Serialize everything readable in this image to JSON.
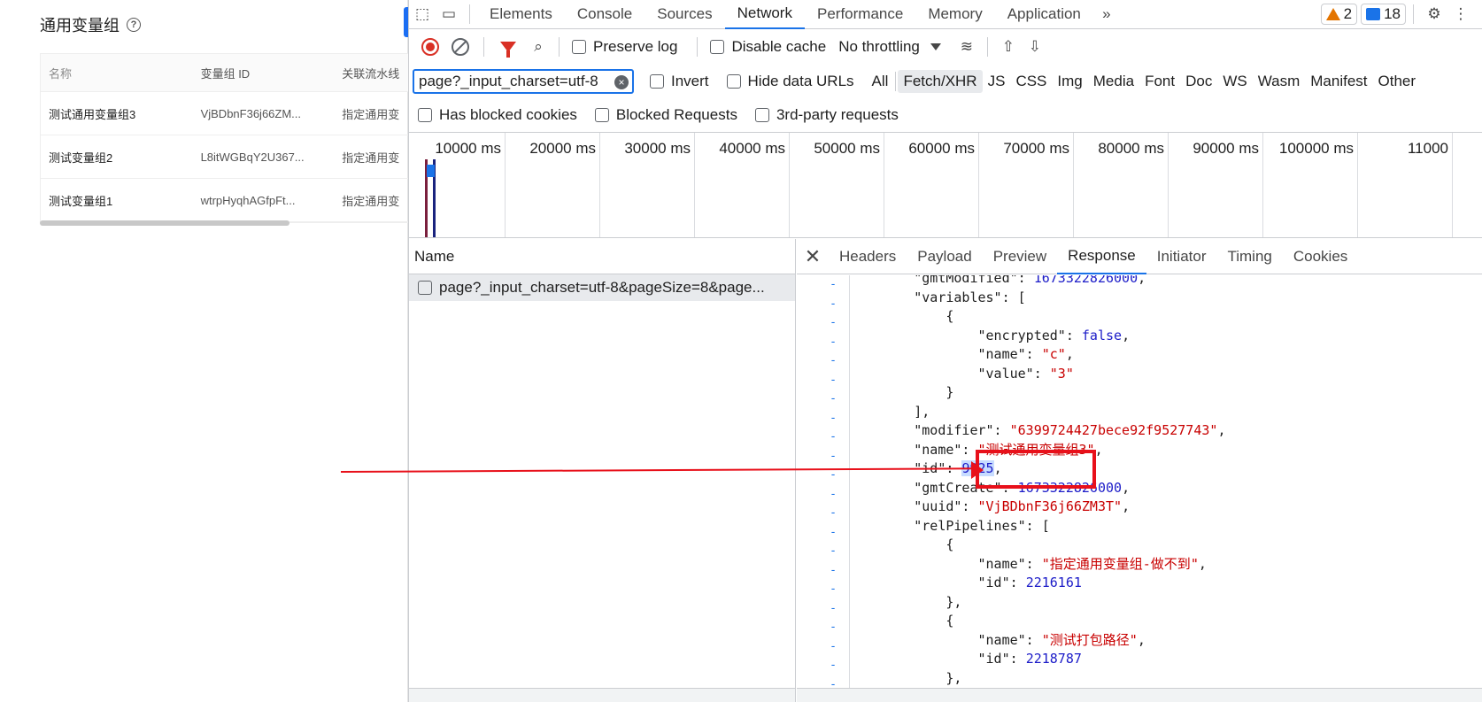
{
  "app": {
    "title": "通用变量组",
    "help_icon": "question-circle-icon",
    "table": {
      "headers": [
        "名称",
        "变量组 ID",
        "关联流水线"
      ],
      "rows": [
        [
          "测试通用变量组3",
          "VjBDbnF36j66ZM...",
          "指定通用变"
        ],
        [
          "测试变量组2",
          "L8itWGBqY2U367...",
          "指定通用变"
        ],
        [
          "测试变量组1",
          "wtrpHyqhAGfpFt...",
          "指定通用变"
        ]
      ]
    }
  },
  "devtools": {
    "tabs": [
      "Elements",
      "Console",
      "Sources",
      "Network",
      "Performance",
      "Memory",
      "Application"
    ],
    "active_tab": "Network",
    "warnings_count": "2",
    "messages_count": "18",
    "toolbar": {
      "preserve_log": "Preserve log",
      "disable_cache": "Disable cache",
      "throttling": "No throttling"
    },
    "filter": {
      "value": "page?_input_charset=utf-8",
      "invert": "Invert",
      "hide_data_urls": "Hide data URLs",
      "types": [
        "All",
        "Fetch/XHR",
        "JS",
        "CSS",
        "Img",
        "Media",
        "Font",
        "Doc",
        "WS",
        "Wasm",
        "Manifest",
        "Other"
      ],
      "active_type": "Fetch/XHR",
      "has_blocked_cookies": "Has blocked cookies",
      "blocked_requests": "Blocked Requests",
      "third_party": "3rd-party requests"
    },
    "overview_ticks": [
      "10000 ms",
      "20000 ms",
      "30000 ms",
      "40000 ms",
      "50000 ms",
      "60000 ms",
      "70000 ms",
      "80000 ms",
      "90000 ms",
      "100000 ms",
      "11000"
    ],
    "name_column": {
      "header": "Name",
      "request": "page?_input_charset=utf-8&pageSize=8&page..."
    },
    "detail_tabs": [
      "Headers",
      "Payload",
      "Preview",
      "Response",
      "Initiator",
      "Timing",
      "Cookies"
    ],
    "active_detail_tab": "Response"
  },
  "response_lines": [
    {
      "i": "        ",
      "key": "gmtModified",
      "num": "1673322826000",
      "tail": ","
    },
    {
      "i": "        ",
      "key": "variables",
      "raw": "[",
      "tail": ""
    },
    {
      "i": "            ",
      "raw": "{"
    },
    {
      "i": "                ",
      "key": "encrypted",
      "bool": "false",
      "tail": ","
    },
    {
      "i": "                ",
      "key": "name",
      "str": "\"c\"",
      "tail": ","
    },
    {
      "i": "                ",
      "key": "value",
      "str": "\"3\"",
      "tail": ""
    },
    {
      "i": "            ",
      "raw": "}"
    },
    {
      "i": "        ",
      "raw": "],"
    },
    {
      "i": "        ",
      "key": "modifier",
      "str": "\"6399724427bece92f9527743\"",
      "tail": ","
    },
    {
      "i": "        ",
      "key": "name",
      "str": "\"测试通用变量组3\"",
      "tail": ","
    },
    {
      "i": "        ",
      "key": "id",
      "numhl": "9925",
      "tail": ","
    },
    {
      "i": "        ",
      "key": "gmtCreate",
      "num": "1673322826000",
      "tail": ","
    },
    {
      "i": "        ",
      "key": "uuid",
      "str": "\"VjBDbnF36j66ZM3T\"",
      "tail": ","
    },
    {
      "i": "        ",
      "key": "relPipelines",
      "raw": "[",
      "tail": ""
    },
    {
      "i": "            ",
      "raw": "{"
    },
    {
      "i": "                ",
      "key": "name",
      "str": "\"指定通用变量组-做不到\"",
      "tail": ","
    },
    {
      "i": "                ",
      "key": "id",
      "num": "2216161",
      "tail": ""
    },
    {
      "i": "            ",
      "raw": "},"
    },
    {
      "i": "            ",
      "raw": "{"
    },
    {
      "i": "                ",
      "key": "name",
      "str": "\"测试打包路径\"",
      "tail": ","
    },
    {
      "i": "                ",
      "key": "id",
      "num": "2218787",
      "tail": ""
    },
    {
      "i": "            ",
      "raw": "},"
    }
  ],
  "colors": {
    "annotation": "#e8101a",
    "accent": "#1a73e8"
  }
}
